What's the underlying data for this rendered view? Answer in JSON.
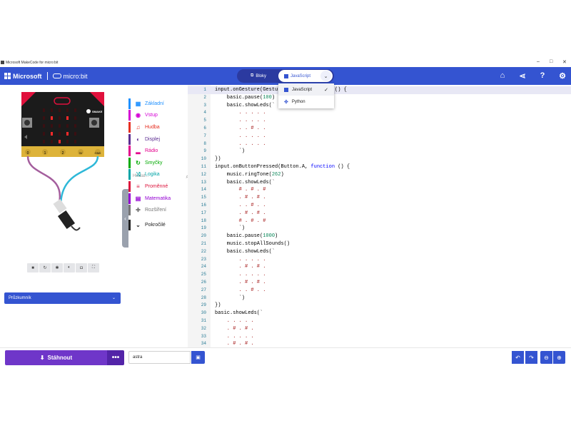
{
  "window": {
    "title": "Microsoft MakeCode for micro:bit",
    "minimize": "–",
    "maximize": "□",
    "close": "✕"
  },
  "header": {
    "brand": "Microsoft",
    "product": "micro:bit",
    "editor_toggle": {
      "blocks_label": "Bloky",
      "javascript_label": "JavaScript"
    },
    "icons": [
      "home-icon",
      "share-icon",
      "help-icon",
      "settings-icon"
    ]
  },
  "language_menu": {
    "items": [
      {
        "label": "JavaScript",
        "selected": true
      },
      {
        "label": "Python",
        "selected": false
      }
    ]
  },
  "simulator": {
    "logo_label": "SMAKE",
    "explorer_label": "Průzkumník",
    "pins": [
      "0",
      "1",
      "2",
      "3V",
      "GND"
    ]
  },
  "toolbox": {
    "search_placeholder": "Hledat...",
    "categories": [
      {
        "label": "Základní",
        "color": "#1e90ff",
        "icon": "▦"
      },
      {
        "label": "Vstup",
        "color": "#d400d4",
        "icon": "◉"
      },
      {
        "label": "Hudba",
        "color": "#e63022",
        "icon": "♫"
      },
      {
        "label": "Displej",
        "color": "#5c2d91",
        "icon": "◐"
      },
      {
        "label": "Rádio",
        "color": "#e3008c",
        "icon": "▂"
      },
      {
        "label": "Smyčky",
        "color": "#00aa00",
        "icon": "↻"
      },
      {
        "label": "Logika",
        "color": "#00a4a6",
        "icon": "⤨"
      },
      {
        "label": "Proměnné",
        "color": "#dc143c",
        "icon": "≡"
      },
      {
        "label": "Matematika",
        "color": "#9400d3",
        "icon": "▤"
      },
      {
        "label": "Rozšíření",
        "color": "#757575",
        "icon": "✚"
      },
      {
        "label": "Pokročilé",
        "color": "#222222",
        "icon": "⌄"
      }
    ]
  },
  "code": {
    "lines": [
      "input.onGesture(Gesture.Shake, function () {",
      "    basic.pause(100)",
      "    basic.showLeds(`",
      "        . . . . .",
      "        . . . . .",
      "        . . # . .",
      "        . . . . .",
      "        . . . . .",
      "        `)",
      "})",
      "input.onButtonPressed(Button.A, function () {",
      "    music.ringTone(262)",
      "    basic.showLeds(`",
      "        # . # . #",
      "        . # . # .",
      "        . . # . .",
      "        . # . # .",
      "        # . # . #",
      "        `)",
      "    basic.pause(1000)",
      "    music.stopAllSounds()",
      "    basic.showLeds(`",
      "        . . . . .",
      "        . # . # .",
      "        . . . . .",
      "        . # . # .",
      "        . . # . .",
      "        `)",
      "})",
      "basic.showLeds(`",
      "    . . . . .",
      "    . # . # .",
      "    . . . . .",
      "    . # . # ."
    ]
  },
  "bottom": {
    "download_label": "Stáhnout",
    "more_label": "•••",
    "project_name": "astra"
  }
}
